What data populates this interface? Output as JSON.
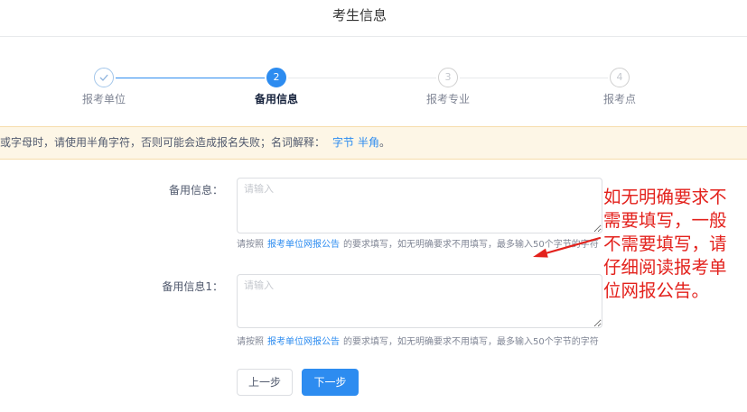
{
  "page": {
    "title": "考生信息"
  },
  "steps": [
    {
      "label": "报考单位",
      "completed": true,
      "active": false,
      "icon": "checkmark-icon"
    },
    {
      "number": "2",
      "label": "备用信息",
      "completed": false,
      "active": true
    },
    {
      "number": "3",
      "label": "报考专业",
      "completed": false,
      "active": false
    },
    {
      "number": "4",
      "label": "报考点",
      "completed": false,
      "active": false
    }
  ],
  "notice": {
    "text": "或字母时，请使用半角字符，否则可能会造成报名失败；名词解释：",
    "link_byte": "字节",
    "link_halfwidth": "半角",
    "end": "。"
  },
  "form": {
    "fields": [
      {
        "label": "备用信息：",
        "placeholder": "请输入",
        "hint_before": "请按照",
        "hint_link": "报考单位网报公告",
        "hint_after": "的要求填写，如无明确要求不用填写，最多输入50个字节的字符"
      },
      {
        "label": "备用信息1：",
        "placeholder": "请输入",
        "hint_before": "请按照",
        "hint_link": "报考单位网报公告",
        "hint_after": "的要求填写，如无明确要求不用填写，最多输入50个字节的字符"
      }
    ]
  },
  "buttons": {
    "prev": "上一步",
    "next": "下一步"
  },
  "annotation": {
    "lines": [
      "如无明确要求不",
      "需要填写，一般",
      "不需要填写，请",
      "仔细阅读报考单",
      "位网报公告。"
    ],
    "arrow_icon": "red-arrow-icon"
  },
  "colors": {
    "primary": "#2d8cf0",
    "annotation": "#e3211c",
    "notice_bg": "#fdf6e6"
  }
}
